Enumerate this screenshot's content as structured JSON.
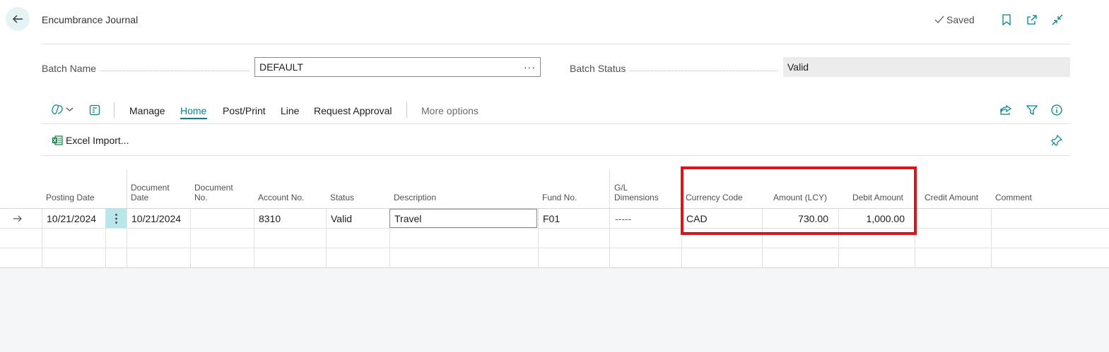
{
  "header": {
    "title": "Encumbrance Journal",
    "saved_label": "Saved"
  },
  "batch": {
    "name_label": "Batch Name",
    "name_value": "DEFAULT",
    "status_label": "Batch Status",
    "status_value": "Valid"
  },
  "actions": {
    "items": [
      "Manage",
      "Home",
      "Post/Print",
      "Line",
      "Request Approval"
    ],
    "more_options": "More options",
    "excel_import": "Excel Import..."
  },
  "grid": {
    "columns": {
      "posting_date": "Posting Date",
      "document_date": "Document Date",
      "document_no": "Document No.",
      "account_no": "Account No.",
      "status": "Status",
      "description": "Description",
      "fund_no": "Fund No.",
      "gl_dimensions": "G/L Dimensions",
      "currency_code": "Currency Code",
      "amount_lcy": "Amount (LCY)",
      "debit_amount": "Debit Amount",
      "credit_amount": "Credit Amount",
      "comment": "Comment"
    },
    "row": {
      "posting_date": "10/21/2024",
      "document_date": "10/21/2024",
      "document_no": "",
      "account_no": "8310",
      "status": "Valid",
      "description": "Travel",
      "fund_no": "F01",
      "gl_dimensions": "-----",
      "currency_code": "CAD",
      "amount_lcy": "730.00",
      "debit_amount": "1,000.00",
      "credit_amount": "",
      "comment": ""
    }
  },
  "colors": {
    "accent": "#00838f",
    "highlight": "#e0121b"
  }
}
